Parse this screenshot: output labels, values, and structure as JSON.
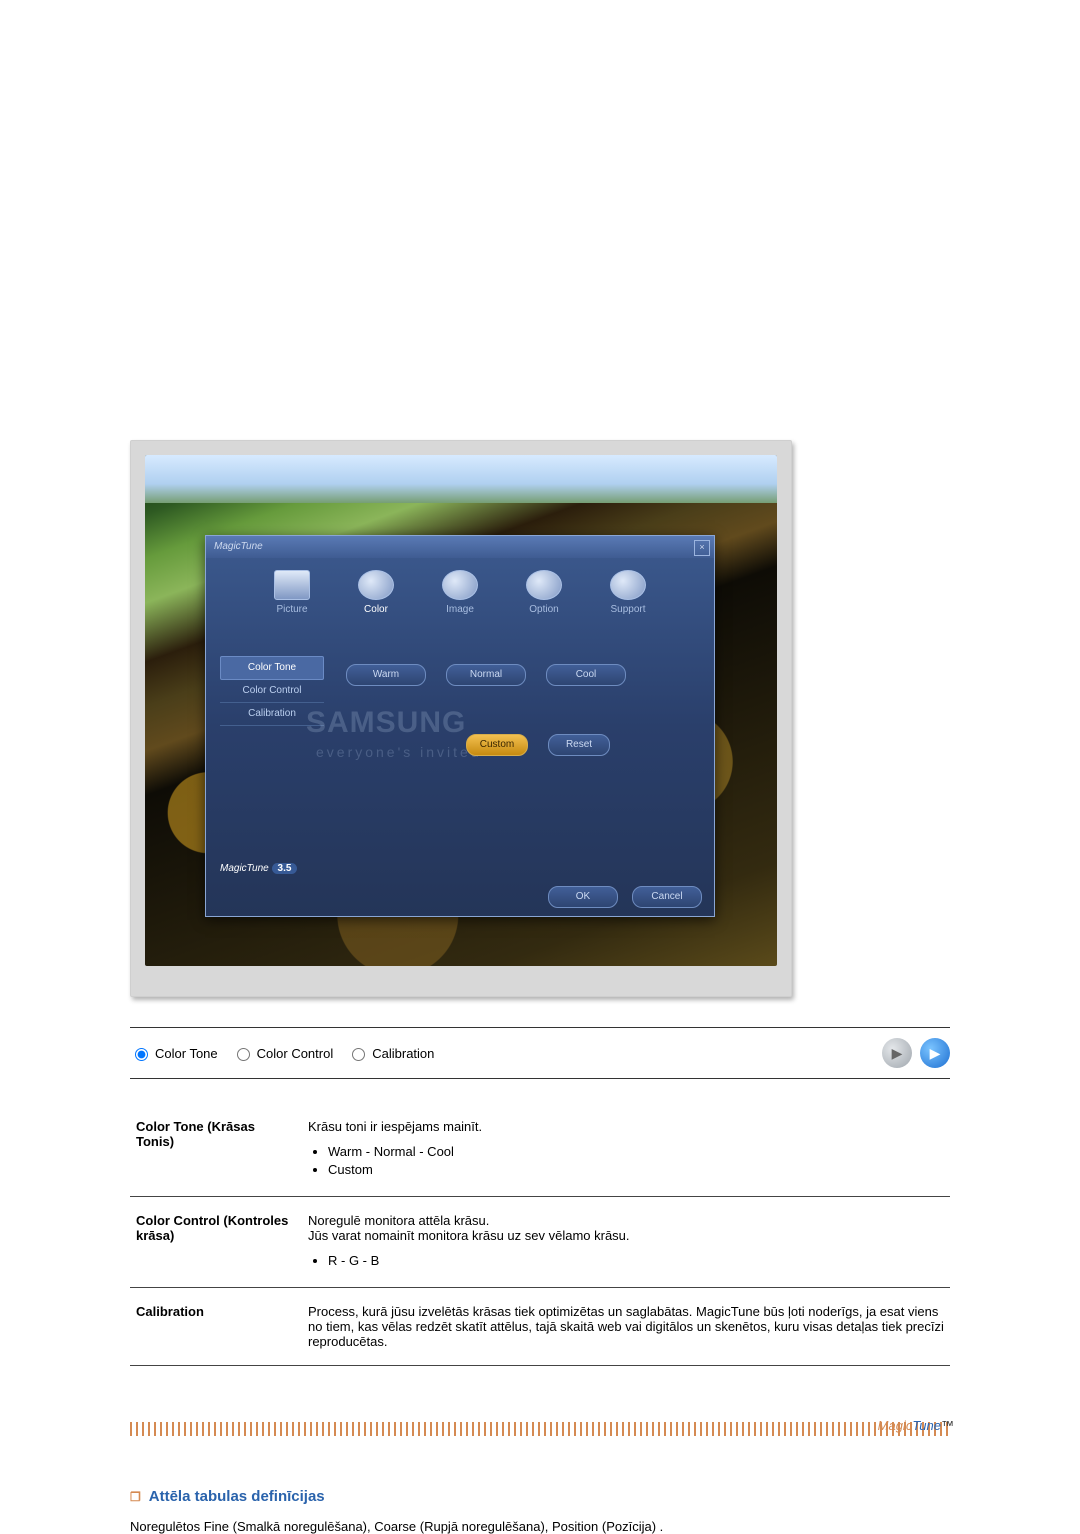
{
  "app": {
    "title": "MagicTune",
    "nav": {
      "picture": "Picture",
      "color": "Color",
      "image": "Image",
      "option": "Option",
      "support": "Support"
    },
    "side": {
      "color_tone": "Color Tone",
      "color_control": "Color Control",
      "calibration": "Calibration"
    },
    "tones": {
      "warm": "Warm",
      "normal": "Normal",
      "cool": "Cool"
    },
    "custom": "Custom",
    "reset": "Reset",
    "ok": "OK",
    "cancel": "Cancel",
    "watermark1": "SAMSUNG",
    "watermark2": "everyone's  invited",
    "logo": "MagicTune",
    "version": "3.5"
  },
  "radios": {
    "color_tone": "Color Tone",
    "color_control": "Color Control",
    "calibration": "Calibration"
  },
  "table": {
    "color_tone_label": "Color Tone (Krāsas Tonis)",
    "color_tone_desc": "Krāsu toni ir iespējams mainīt.",
    "color_tone_b1": "Warm - Normal - Cool",
    "color_tone_b2": "Custom",
    "color_control_label": "Color Control (Kontroles krāsa)",
    "color_control_l1": "Noregulē monitora attēla krāsu.",
    "color_control_l2": "Jūs varat nomainīt monitora krāsu uz sev vēlamo krāsu.",
    "color_control_b1": "R - G - B",
    "calibration_label": "Calibration",
    "calibration_desc": "Process, kurā jūsu izvelētās krāsas tiek optimizētas un saglabātas. MagicTune būs ļoti noderīgs, ja esat viens no tiem, kas vēlas redzēt skatīt attēlus, tajā skaitā web vai digitālos un skenētos, kuru visas detaļas tiek precīzi reproducētas."
  },
  "logo_parts": {
    "m": "Magic",
    "t": "Tune"
  },
  "section": {
    "heading": "Attēla tabulas definīcijas",
    "body": "Noregulētos Fine (Smalkā noregulēšana), Coarse (Rupjā noregulēšana), Position (Pozīcija) ."
  }
}
